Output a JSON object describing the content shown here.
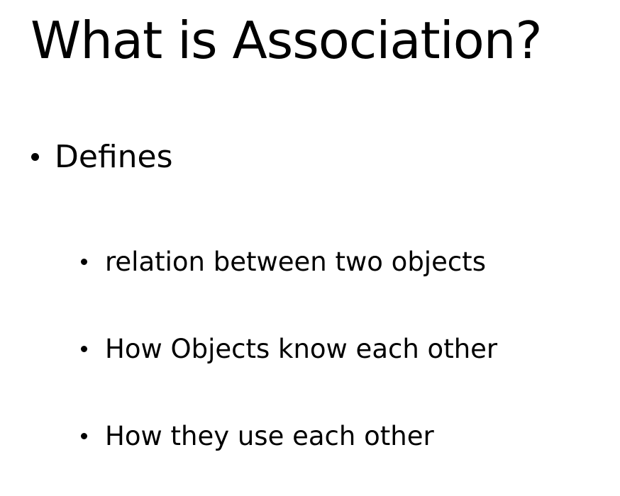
{
  "slide": {
    "title": "What is Association?",
    "bullets": [
      {
        "text": "Defines",
        "sub_bullets": [
          "relation between two objects",
          "How Objects know each other",
          "How they use each other"
        ]
      }
    ]
  }
}
